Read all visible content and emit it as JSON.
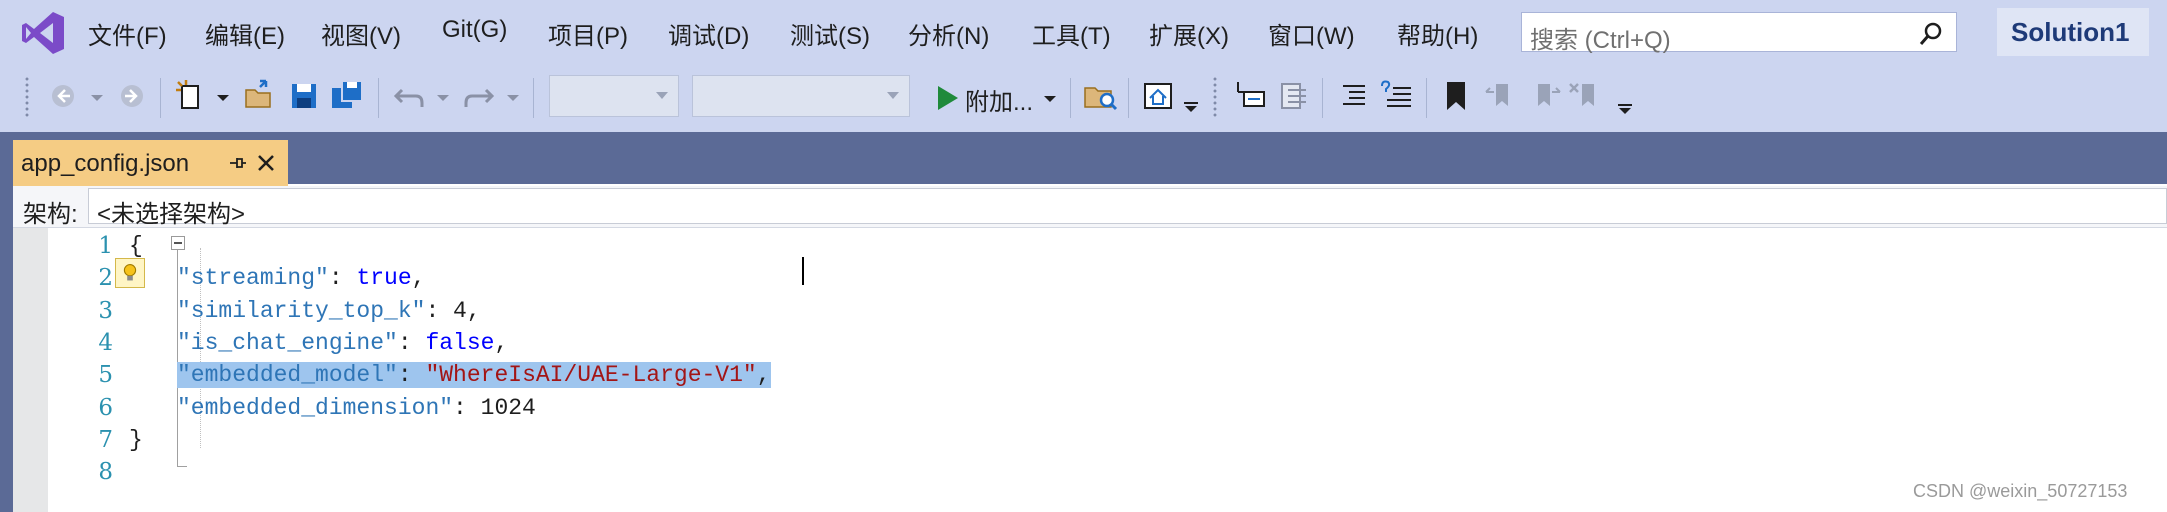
{
  "menubar": {
    "items": [
      "文件(F)",
      "编辑(E)",
      "视图(V)",
      "Git(G)",
      "项目(P)",
      "调试(D)",
      "测试(S)",
      "分析(N)",
      "工具(T)",
      "扩展(X)",
      "窗口(W)",
      "帮助(H)"
    ],
    "search_placeholder": "搜索 (Ctrl+Q)",
    "solution_name": "Solution1"
  },
  "toolbar": {
    "attach_label": "附加...",
    "icons": [
      "navigate-back-icon",
      "navigate-forward-icon",
      "new-project-icon",
      "open-file-icon",
      "save-icon",
      "save-all-icon",
      "undo-icon",
      "redo-icon",
      "start-icon",
      "find-in-files-icon",
      "solution-explorer-icon",
      "comment-icon",
      "uncomment-icon",
      "indent-icon",
      "outdent-icon",
      "bookmark-icon"
    ]
  },
  "tab": {
    "title": "app_config.json"
  },
  "navbar": {
    "label": "架构:",
    "schema_value": "<未选择架构>"
  },
  "editor": {
    "line_numbers": [
      "1",
      "2",
      "3",
      "4",
      "5",
      "6",
      "7",
      "8"
    ],
    "lines": [
      {
        "parts": [
          {
            "t": "{",
            "c": "p"
          }
        ]
      },
      {
        "parts": [
          {
            "t": "\"streaming\"",
            "c": "k"
          },
          {
            "t": ": ",
            "c": "p"
          },
          {
            "t": "true",
            "c": "kw"
          },
          {
            "t": ",",
            "c": "p"
          }
        ]
      },
      {
        "parts": [
          {
            "t": "\"similarity_top_k\"",
            "c": "k"
          },
          {
            "t": ": 4,",
            "c": "p"
          }
        ]
      },
      {
        "parts": [
          {
            "t": "\"is_chat_engine\"",
            "c": "k"
          },
          {
            "t": ": ",
            "c": "p"
          },
          {
            "t": "false",
            "c": "kw"
          },
          {
            "t": ",",
            "c": "p"
          }
        ]
      },
      {
        "parts": [
          {
            "t": "\"embedded_model\"",
            "c": "k"
          },
          {
            "t": ": ",
            "c": "p"
          },
          {
            "t": "\"WhereIsAI/UAE-Large-V1\"",
            "c": "s"
          },
          {
            "t": ",",
            "c": "p"
          }
        ],
        "selected": true
      },
      {
        "parts": [
          {
            "t": "\"embedded_dimension\"",
            "c": "k"
          },
          {
            "t": ": 1024",
            "c": "p"
          }
        ]
      },
      {
        "parts": [
          {
            "t": "}",
            "c": "p"
          }
        ]
      },
      {
        "parts": []
      }
    ]
  },
  "watermark": "CSDN @weixin_50727153",
  "colors": {
    "chrome": "#ccd5f0",
    "tabstrip": "#5b6a96",
    "active_tab": "#f5cc84",
    "line_number": "#2b91af",
    "json_key": "#2e75b6",
    "json_keyword": "#0000ff",
    "json_string": "#a31515",
    "selection": "#9ec5ee"
  }
}
